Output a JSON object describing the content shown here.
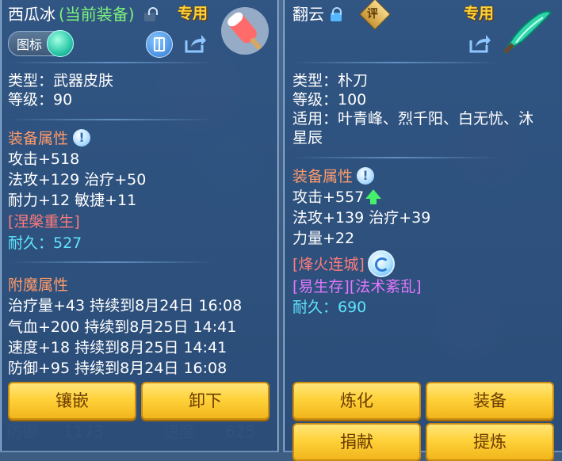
{
  "left": {
    "name": "西瓜冰",
    "equipped_tag": "(当前装备)",
    "special_badge": "专用",
    "icon_chip_label": "图标",
    "type_line": "类型：武器皮肤",
    "level_line": "等级：90",
    "attr_header": "装备属性",
    "attrs": [
      "攻击+518",
      "法攻+129 治疗+50",
      "耐力+12 敏捷+11"
    ],
    "special_effect": "[涅槃重生]",
    "durability": "耐久：527",
    "enchant_header": "附魔属性",
    "enchants": [
      "治疗量+43 持续到8月24日 16:08",
      "气血+200 持续到8月25日 14:41",
      "速度+18 持续到8月25日 14:41",
      "防御+95 持续到8月24日 16:08"
    ],
    "buttons": {
      "inlay": "镶嵌",
      "unequip": "卸下"
    }
  },
  "right": {
    "name": "翻云",
    "review_badge": "评",
    "special_badge": "专用",
    "type_line": "类型：朴刀",
    "level_line": "等级：100",
    "fit_line": "适用：叶青峰、烈千阳、白无忧、沐",
    "fit_line2": "星辰",
    "attr_header": "装备属性",
    "attrs": [
      "攻击+557",
      "法攻+139 治疗+39",
      "力量+22"
    ],
    "special_effect": "[烽火连城]",
    "special_effect2": "[易生存][法术紊乱]",
    "durability": "耐久：690",
    "buttons": {
      "refine": "炼化",
      "equip": "装备",
      "donate": "捐献",
      "extract": "提炼"
    }
  },
  "background": {
    "stat_left": "防御",
    "stat_left_value": "1173",
    "stat_right": "速度",
    "stat_right_value": "625"
  }
}
